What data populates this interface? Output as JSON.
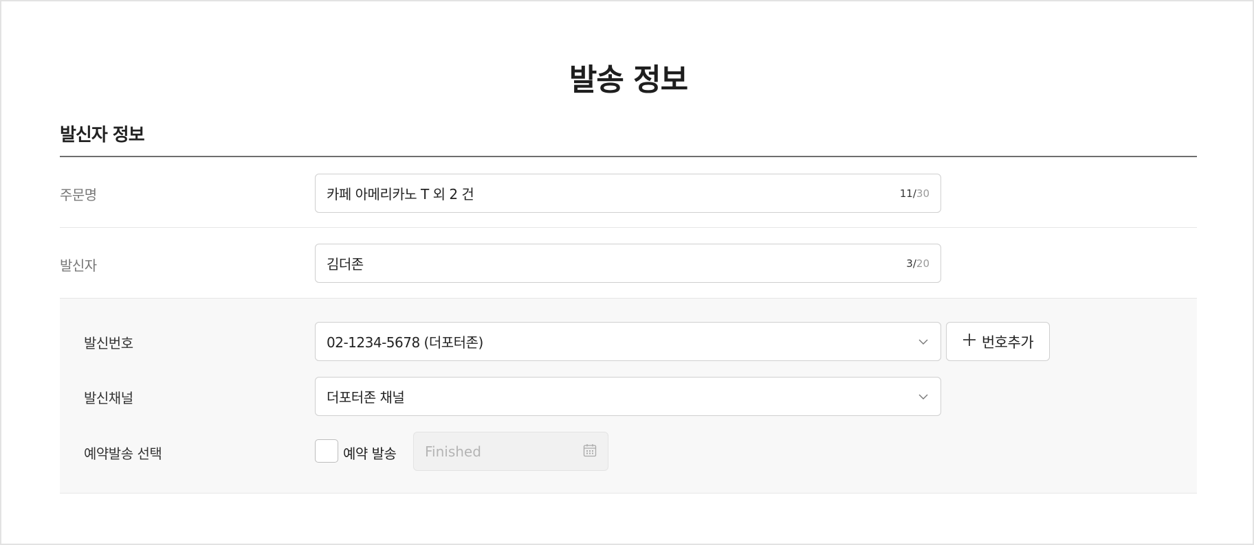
{
  "page": {
    "title": "발송 정보"
  },
  "section": {
    "title": "발신자 정보"
  },
  "order_name": {
    "label": "주문명",
    "value": "카페 아메리카노 T 외 2 건",
    "count": "11",
    "max": "30"
  },
  "sender": {
    "label": "발신자",
    "value": "김더존",
    "count": "3",
    "max": "20"
  },
  "sender_number": {
    "label": "발신번호",
    "selected": "02-1234-5678 (더포터존)",
    "add_button_label": "번호추가"
  },
  "sender_channel": {
    "label": "발신채널",
    "selected": "더포터존 채널"
  },
  "reservation": {
    "label": "예약발송 선택",
    "checkbox_label": "예약 발송",
    "checked": false,
    "date_placeholder": "Finished"
  },
  "colors": {
    "border": "#cfcfcf",
    "panel_bg": "#f8f8f8",
    "muted_text": "#777777"
  },
  "icons": [
    "chevron-down-icon",
    "plus-icon",
    "calendar-icon"
  ]
}
